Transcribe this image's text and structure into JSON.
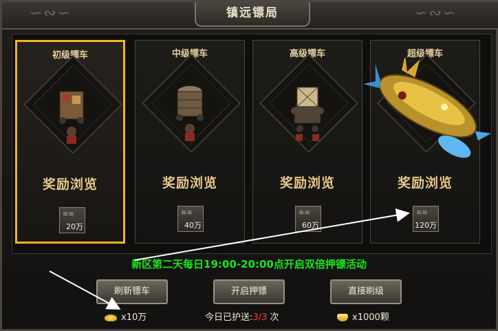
{
  "window": {
    "title": "镇远镖局"
  },
  "carts": [
    {
      "title": "初级镖车",
      "reward_label": "奖励浏览",
      "reward_icon": "gold-coin-pile",
      "reward_amount": "20万",
      "selected": true
    },
    {
      "title": "中级镖车",
      "reward_label": "奖励浏览",
      "reward_icon": "gold-coin-pile",
      "reward_amount": "40万",
      "selected": false
    },
    {
      "title": "高级镖车",
      "reward_label": "奖励浏览",
      "reward_icon": "gold-coin-pile",
      "reward_amount": "60万",
      "selected": false
    },
    {
      "title": "超级镖车",
      "reward_label": "奖励浏览",
      "reward_icon": "gold-coin-pile",
      "reward_amount": "120万",
      "selected": false
    }
  ],
  "notice": "新区第二天每日19:00-20:00点开启双倍押镖活动",
  "buttons": {
    "refresh": "刷新镖车",
    "start": "开启押镖",
    "direct": "直接刷级"
  },
  "costs": {
    "refresh": "x10万",
    "direct": "x1000颗"
  },
  "escort": {
    "label": "今日已护送:",
    "done": "3",
    "sep": "/",
    "total": "3",
    "unit": "次"
  },
  "colors": {
    "selected_border": "#f2b51c",
    "notice": "#19e61d",
    "count": "#ff3a2a"
  }
}
